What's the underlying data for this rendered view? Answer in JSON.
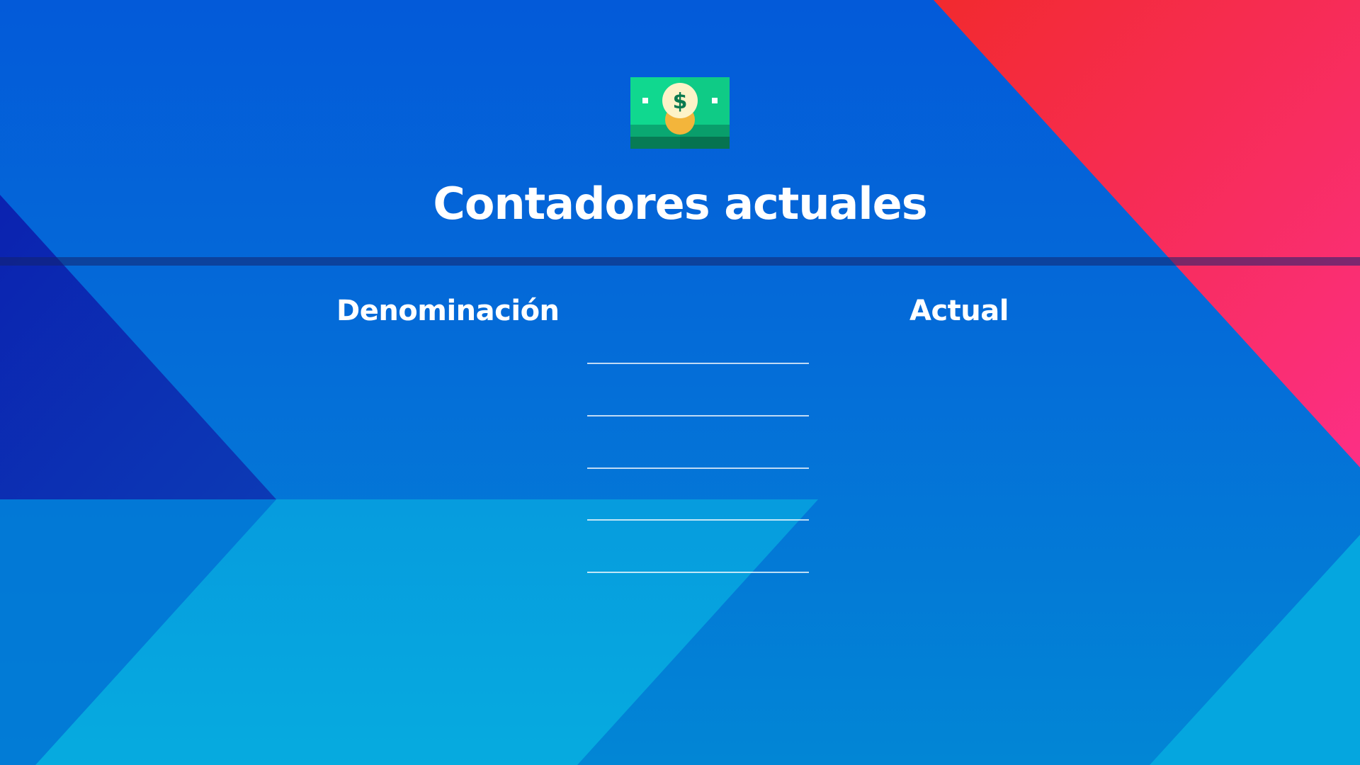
{
  "colors": {
    "background_top": "#035ad9",
    "background_bottom": "#0286d5",
    "accent_red": "#f22a2e",
    "accent_pink": "#fc2f85",
    "accent_cyan": "#06aee0",
    "dark_blue_triangle": "#0a2bb5",
    "icon_green": "#1ecf8a",
    "text": "#ffffff"
  },
  "header": {
    "icon": "money-bill-icon",
    "title": "Contadores actuales"
  },
  "table": {
    "columns": [
      "Denominación",
      "Actual"
    ],
    "rows": [
      {
        "denominacion": "",
        "actual": ""
      },
      {
        "denominacion": "",
        "actual": ""
      },
      {
        "denominacion": "",
        "actual": ""
      },
      {
        "denominacion": "",
        "actual": ""
      },
      {
        "denominacion": "",
        "actual": ""
      }
    ]
  }
}
